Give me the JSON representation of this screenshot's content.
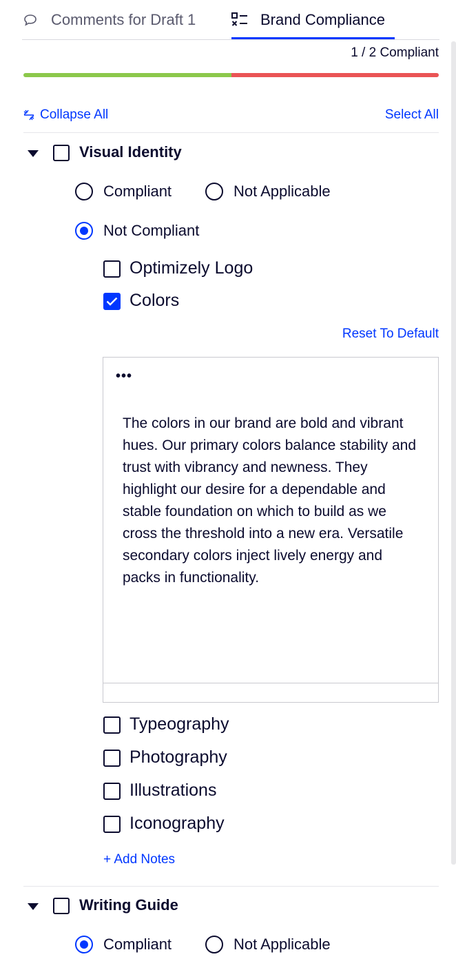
{
  "tabs": [
    {
      "label": "Comments for Draft 1",
      "icon": "comment-icon",
      "active": false
    },
    {
      "label": "Brand Compliance",
      "icon": "checklist-icon",
      "active": true
    }
  ],
  "status_text": "1 / 2 Compliant",
  "progress": {
    "compliant": 1,
    "total": 2,
    "ok_color": "#8cc84b",
    "bad_color": "#ea5455"
  },
  "toolbar": {
    "collapse_label": "Collapse All",
    "select_all_label": "Select All"
  },
  "sections": [
    {
      "title": "Visual Identity",
      "expanded": true,
      "options": {
        "compliant": "Compliant",
        "not_applicable": "Not Applicable",
        "not_compliant": "Not Compliant"
      },
      "selected": "Not Compliant",
      "items": [
        {
          "label": "Optimizely Logo",
          "checked": false
        },
        {
          "label": "Colors",
          "checked": true
        },
        {
          "label": "Typeography",
          "checked": false
        },
        {
          "label": "Photography",
          "checked": false
        },
        {
          "label": "Illustrations",
          "checked": false
        },
        {
          "label": "Iconography",
          "checked": false
        }
      ],
      "reset_label": "Reset To Default",
      "editor_menu": "•••",
      "note_text": "The colors in our brand are bold and vibrant hues. Our primary colors balance stability and trust with vibrancy and newness. They highlight our desire for a dependable and stable foundation on which to build as we cross the threshold into a new era. Versatile secondary colors inject lively energy and packs in functionality.",
      "add_notes_label": "+ Add Notes"
    },
    {
      "title": "Writing Guide",
      "expanded": true,
      "options": {
        "compliant": "Compliant",
        "not_applicable": "Not Applicable"
      },
      "selected": "Compliant"
    }
  ],
  "accent_color": "#0037ff"
}
